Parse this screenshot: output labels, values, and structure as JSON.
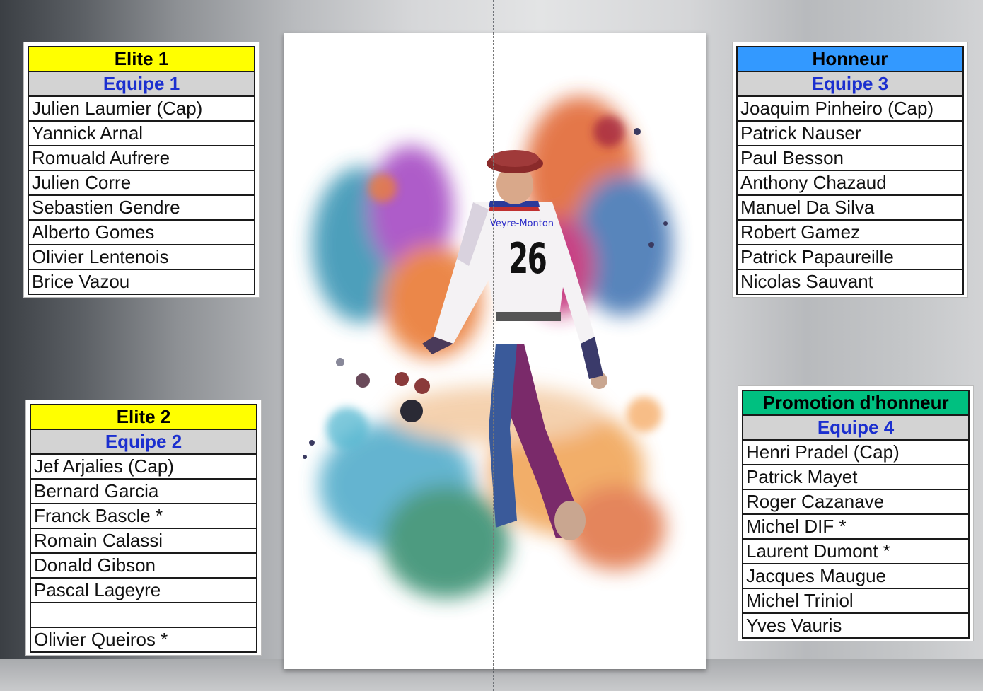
{
  "teams": [
    {
      "division": "Elite 1",
      "division_color": "#ffff00",
      "team": "Equipe 1",
      "players": [
        "Julien Laumier (Cap)",
        "Yannick Arnal",
        "Romuald Aufrere",
        "Julien Corre",
        "Sebastien Gendre",
        "Alberto Gomes",
        "Olivier Lentenois",
        "Brice Vazou"
      ]
    },
    {
      "division": "Elite 2",
      "division_color": "#ffff00",
      "team": "Equipe 2",
      "players": [
        "Jef Arjalies (Cap)",
        "Bernard Garcia",
        "Franck Bascle *",
        "Romain Calassi",
        "Donald Gibson",
        "Pascal Lageyre",
        "",
        "Olivier Queiros *"
      ]
    },
    {
      "division": "Honneur",
      "division_color": "#3399ff",
      "team": "Equipe 3",
      "players": [
        "Joaquim Pinheiro (Cap)",
        "Patrick Nauser",
        "Paul Besson",
        "Anthony Chazaud",
        "Manuel Da Silva",
        "Robert Gamez",
        "Patrick Papaureille",
        "Nicolas Sauvant"
      ]
    },
    {
      "division": "Promotion d'honneur",
      "division_color": "#00c080",
      "team": "Equipe 4",
      "players": [
        "Henri Pradel (Cap)",
        "Patrick Mayet",
        "Roger Cazanave",
        "Michel DIF *",
        "Laurent Dumont *",
        "Jacques Maugue",
        "Michel Triniol",
        "Yves Vauris"
      ]
    }
  ],
  "poster": {
    "club": "Veyre-Monton",
    "jersey_number": "26"
  }
}
